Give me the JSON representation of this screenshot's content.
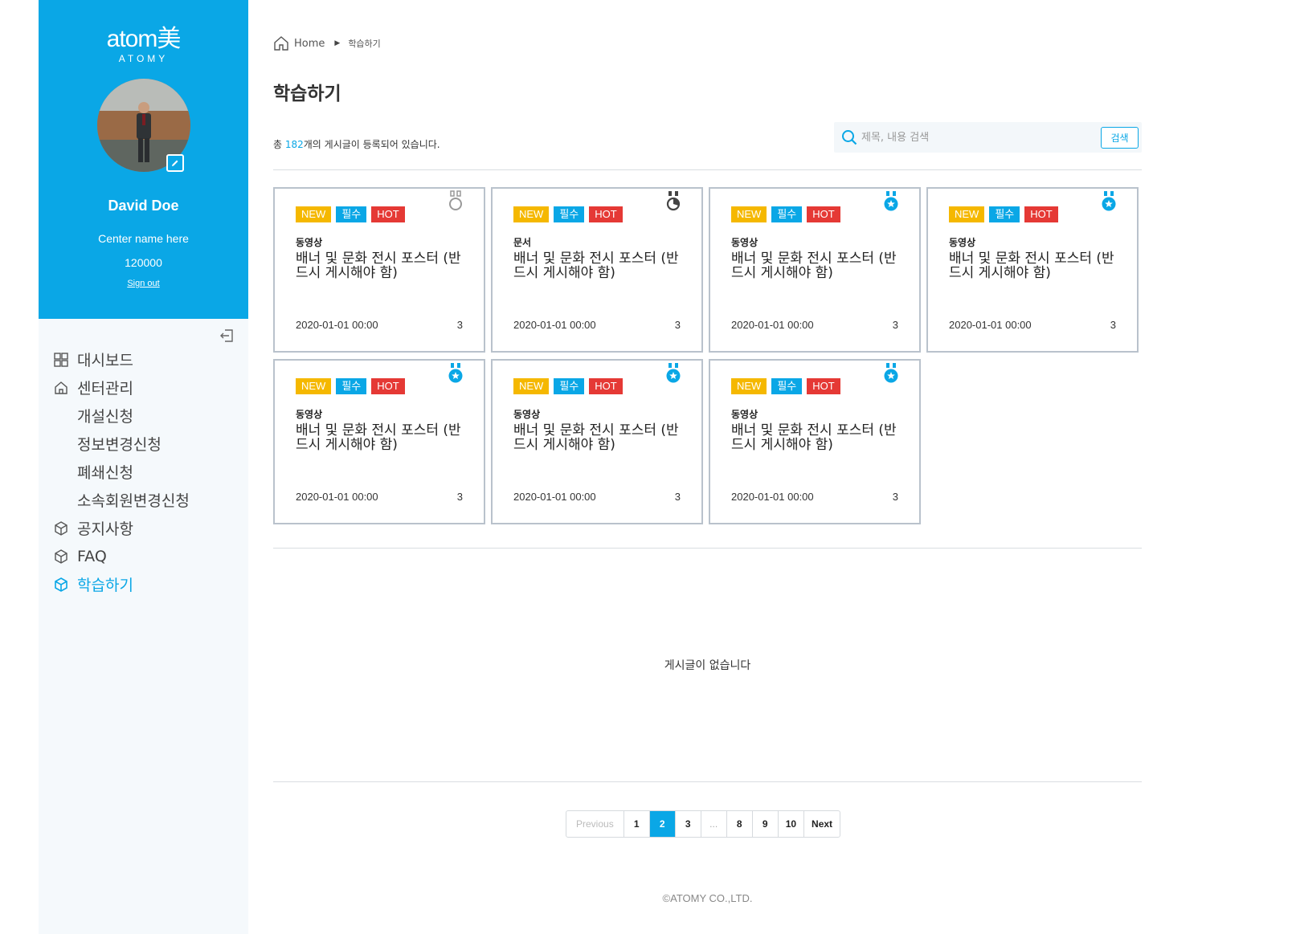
{
  "sidebar": {
    "logo_main": "atom美",
    "logo_sub": "ATOMY",
    "user_name": "David Doe",
    "center_name": "Center name here",
    "member_id": "120000",
    "signout_label": "Sign out",
    "nav": [
      {
        "label": "대시보드",
        "icon": "grid-icon"
      },
      {
        "label": "센터관리",
        "icon": "home-icon"
      },
      {
        "label": "개설신청"
      },
      {
        "label": "정보변경신청"
      },
      {
        "label": "폐쇄신청"
      },
      {
        "label": "소속회원변경신청"
      },
      {
        "label": "공지사항",
        "icon": "box-icon"
      },
      {
        "label": "FAQ",
        "icon": "box-icon"
      },
      {
        "label": "학습하기",
        "icon": "box-icon",
        "active": true
      }
    ]
  },
  "breadcrumb": {
    "home": "Home",
    "current": "학습하기"
  },
  "page_title": "학습하기",
  "total": {
    "prefix": "총 ",
    "count": "182",
    "suffix": "개의 게시글이 등록되어 있습니다."
  },
  "search": {
    "placeholder": "제목, 내용 검색",
    "button": "검색"
  },
  "badges": {
    "new": "NEW",
    "required": "필수",
    "hot": "HOT"
  },
  "cards": [
    {
      "type": "동영상",
      "title": "배너 및 문화 전시 포스터 (반드시 게시해야 함)",
      "date": "2020-01-01 00:00",
      "count": "3",
      "medal": "outline"
    },
    {
      "type": "문서",
      "title": "배너 및 문화 전시 포스터 (반드시 게시해야 함)",
      "date": "2020-01-01 00:00",
      "count": "3",
      "medal": "dark"
    },
    {
      "type": "동영상",
      "title": "배너 및 문화 전시 포스터 (반드시 게시해야 함)",
      "date": "2020-01-01 00:00",
      "count": "3",
      "medal": "blue"
    },
    {
      "type": "동영상",
      "title": "배너 및 문화 전시 포스터 (반드시 게시해야 함)",
      "date": "2020-01-01 00:00",
      "count": "3",
      "medal": "blue"
    },
    {
      "type": "동영상",
      "title": "배너 및 문화 전시 포스터 (반드시 게시해야 함)",
      "date": "2020-01-01 00:00",
      "count": "3",
      "medal": "blue"
    },
    {
      "type": "동영상",
      "title": "배너 및 문화 전시 포스터 (반드시 게시해야 함)",
      "date": "2020-01-01 00:00",
      "count": "3",
      "medal": "blue"
    },
    {
      "type": "동영상",
      "title": "배너 및 문화 전시 포스터 (반드시 게시해야 함)",
      "date": "2020-01-01 00:00",
      "count": "3",
      "medal": "blue"
    }
  ],
  "empty_message": "게시글이 없습니다",
  "pagination": {
    "previous": "Previous",
    "pages": [
      "1",
      "2",
      "3",
      "...",
      "8",
      "9",
      "10"
    ],
    "current": "2",
    "next": "Next"
  },
  "footer": "©ATOMY CO.,LTD.",
  "colors": {
    "accent": "#0aa7e6",
    "new": "#f5b800",
    "hot": "#e53935"
  }
}
